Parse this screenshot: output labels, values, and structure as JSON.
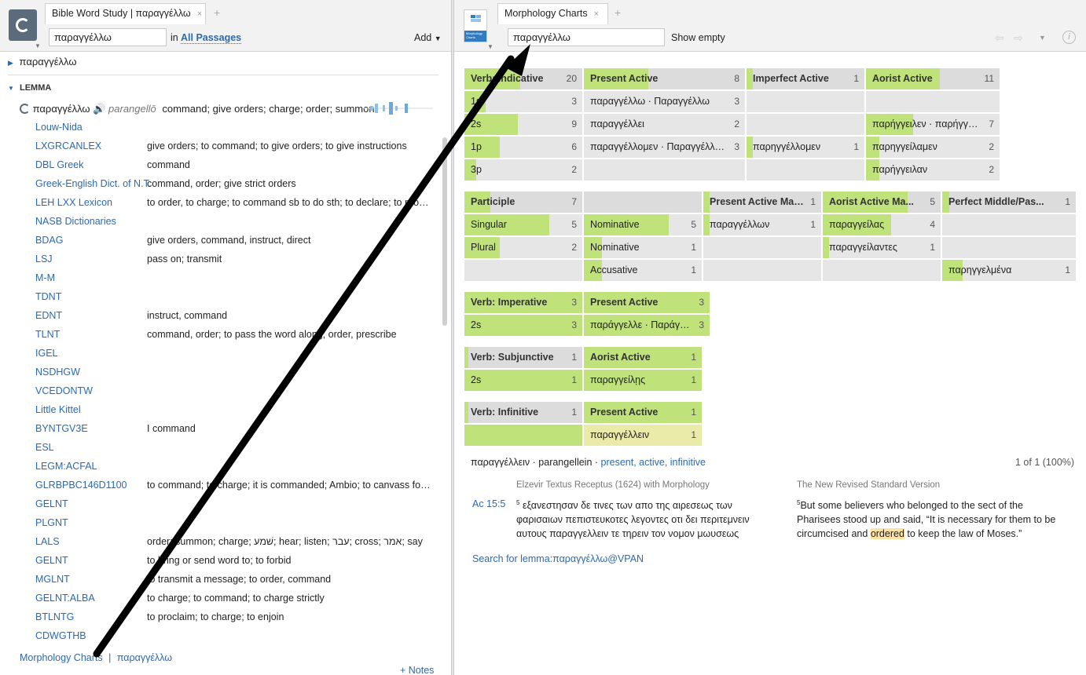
{
  "left": {
    "tab_title": "Bible Word Study | παραγγέλλω",
    "tab_close": "×",
    "tab_plus": "+",
    "search_value": "παραγγέλλω",
    "in_label": "in",
    "range_label": "All Passages",
    "add_label": "Add",
    "word_header": "παραγγέλλω",
    "lemma_header": "LEMMA",
    "lemma": {
      "word": "παραγγέλλω",
      "translit": "parangellō",
      "gloss": "command; give orders; charge; order; summon"
    },
    "rows": [
      {
        "name": "Louw-Nida",
        "def": ""
      },
      {
        "name": "LXGRCANLEX",
        "def": "give orders; to command; to give orders; to give instructions"
      },
      {
        "name": "DBL Greek",
        "def": "command"
      },
      {
        "name": "Greek-English Dict. of N.T.",
        "def": "command, order; give strict orders"
      },
      {
        "name": "LEH LXX Lexicon",
        "def": "to order, to charge; to command sb to do sth; to declare; to proclaim"
      },
      {
        "name": "NASB Dictionaries",
        "def": ""
      },
      {
        "name": "BDAG",
        "def": "give orders, command, instruct, direct"
      },
      {
        "name": "LSJ",
        "def": "pass on; transmit"
      },
      {
        "name": "M-M",
        "def": ""
      },
      {
        "name": "TDNT",
        "def": ""
      },
      {
        "name": "EDNT",
        "def": "instruct, command"
      },
      {
        "name": "TLNT",
        "def": "command, order; to pass the word along; order, prescribe"
      },
      {
        "name": "IGEL",
        "def": ""
      },
      {
        "name": "NSDHGW",
        "def": ""
      },
      {
        "name": "VCEDONTW",
        "def": ""
      },
      {
        "name": "Little Kittel",
        "def": ""
      },
      {
        "name": "BYNTGV3E",
        "def": "I command"
      },
      {
        "name": "ESL",
        "def": ""
      },
      {
        "name": "LEGM:ACFAL",
        "def": ""
      },
      {
        "name": "GLRBPBC146D1100",
        "def": "to command; to charge; it is commanded; Ambio; to canvass for votes"
      },
      {
        "name": "GELNT",
        "def": ""
      },
      {
        "name": "PLGNT",
        "def": ""
      },
      {
        "name": "LALS",
        "def": "order; summon; charge; שׁמע; hear; listen; עבר; cross; אמר; say"
      },
      {
        "name": "GELNT",
        "def": "to bring or send word to; to forbid"
      },
      {
        "name": "MGLNT",
        "def": "to transmit a message; to order, command"
      },
      {
        "name": "GELNT:ALBA",
        "def": "to charge; to command; to charge strictly"
      },
      {
        "name": "BTLNTG",
        "def": "to proclaim; to charge; to enjoin"
      },
      {
        "name": "CDWGTHB",
        "def": ""
      }
    ],
    "footer_link": "Morphology Charts",
    "footer_sep": "|",
    "footer_word": "παραγγέλλω",
    "notes_label": "+ Notes"
  },
  "right": {
    "tab_title": "Morphology Charts",
    "tab_close": "×",
    "tab_plus": "+",
    "icon_caption": "Morphology Charts",
    "search_value": "παραγγέλλω",
    "show_empty_label": "Show empty",
    "info_label": "i",
    "charts": [
      {
        "id": "indicative",
        "top_offset": 0,
        "columns": [
          [
            {
              "t": "Verb: Indicative",
              "n": 20,
              "f": 0.47,
              "h": true
            },
            {
              "t": "1s",
              "n": 3,
              "f": 0.18
            },
            {
              "t": "2s",
              "n": 9,
              "f": 0.45
            },
            {
              "t": "1p",
              "n": 6,
              "f": 0.3
            },
            {
              "t": "3p",
              "n": 2,
              "f": 0.1
            }
          ],
          [
            {
              "t": "Present Active",
              "n": 8,
              "f": 0.4,
              "h": true
            },
            {
              "t": "παραγγέλλω · Παραγγέλλω",
              "n": 3,
              "f": 0.0
            },
            {
              "t": "παραγγέλλει",
              "n": 2,
              "f": 0.0
            },
            {
              "t": "παραγγέλλομεν · Παραγγέλλομεν",
              "n": 3,
              "f": 0.0
            },
            {
              "t": "",
              "n": null,
              "f": 0,
              "blank": true
            }
          ],
          [
            {
              "t": "Imperfect Active",
              "n": 1,
              "f": 0.05,
              "h": true
            },
            {
              "t": "",
              "n": null,
              "f": 0,
              "blank": true
            },
            {
              "t": "",
              "n": null,
              "f": 0,
              "blank": true
            },
            {
              "t": "παρηγγέλλομεν",
              "n": 1,
              "f": 0.05
            },
            {
              "t": "",
              "n": null,
              "f": 0,
              "blank": true
            }
          ],
          [
            {
              "t": "Aorist Active",
              "n": 11,
              "f": 0.55,
              "h": true
            },
            {
              "t": "",
              "n": null,
              "f": 0,
              "blank": true
            },
            {
              "t": "παρήγγειλεν · παρήγγειλαν",
              "n": 7,
              "f": 0.35
            },
            {
              "t": "παρηγγείλαμεν",
              "n": 2,
              "f": 0.1
            },
            {
              "t": "παρήγγειλαν",
              "n": 2,
              "f": 0.1
            }
          ]
        ]
      }
    ],
    "participle": [
      [
        {
          "t": "Participle",
          "n": 7,
          "f": 0.22,
          "h": true
        },
        {
          "t": "Singular",
          "n": 5,
          "f": 0.72
        },
        {
          "t": "Plural",
          "n": 2,
          "f": 0.3
        },
        {
          "t": "",
          "n": null,
          "f": 0,
          "blank": true
        }
      ],
      [
        {
          "t": "",
          "n": null,
          "f": 0,
          "h": true,
          "blank": true
        },
        {
          "t": "Nominative",
          "n": 5,
          "f": 0.72
        },
        {
          "t": "Nominative",
          "n": 1,
          "f": 0.15
        },
        {
          "t": "Accusative",
          "n": 1,
          "f": 0.15
        }
      ],
      [
        {
          "t": "Present Active Mas...",
          "n": 1,
          "f": 0.05,
          "h": true
        },
        {
          "t": "παραγγέλλων",
          "n": 1,
          "f": 0.05
        },
        {
          "t": "",
          "n": null,
          "f": 0,
          "blank": true
        },
        {
          "t": "",
          "n": null,
          "f": 0,
          "blank": true
        }
      ],
      [
        {
          "t": "Aorist Active Ma...",
          "n": 5,
          "f": 0.72,
          "h": true
        },
        {
          "t": "παραγγείλας",
          "n": 4,
          "f": 0.58
        },
        {
          "t": "παραγγείλαντες",
          "n": 1,
          "f": 0.05
        },
        {
          "t": "",
          "n": null,
          "f": 0,
          "blank": true
        }
      ],
      [
        {
          "t": "Perfect Middle/Pas...",
          "n": 1,
          "f": 0.05,
          "h": true
        },
        {
          "t": "",
          "n": null,
          "f": 0,
          "blank": true
        },
        {
          "t": "",
          "n": null,
          "f": 0,
          "blank": true
        },
        {
          "t": "παρηγγελμένα",
          "n": 1,
          "f": 0.15
        }
      ]
    ],
    "imperative": [
      [
        {
          "t": "Verb: Imperative",
          "n": 3,
          "f": 1.0,
          "h": true
        },
        {
          "t": "2s",
          "n": 3,
          "f": 1.0
        }
      ],
      [
        {
          "t": "Present Active",
          "n": 3,
          "f": 1.0,
          "h": true
        },
        {
          "t": "παράγγελλε · Παράγγελλε",
          "n": 3,
          "f": 1.0
        }
      ]
    ],
    "subjunctive": [
      [
        {
          "t": "Verb: Subjunctive",
          "n": 1,
          "f": 0.03,
          "h": true
        },
        {
          "t": "2s",
          "n": 1,
          "f": 1.0
        }
      ],
      [
        {
          "t": "Aorist Active",
          "n": 1,
          "f": 1.0,
          "h": true
        },
        {
          "t": "παραγγείλῃς",
          "n": 1,
          "f": 1.0
        }
      ]
    ],
    "infinitive": [
      [
        {
          "t": "Verb: Infinitive",
          "n": 1,
          "f": 0.03,
          "h": true
        },
        {
          "t": "",
          "n": null,
          "f": 1.0
        }
      ],
      [
        {
          "t": "Present Active",
          "n": 1,
          "f": 1.0,
          "h": true
        },
        {
          "t": "παραγγέλλειν",
          "n": 1,
          "f": 0,
          "sel": true
        }
      ]
    ],
    "selection": {
      "word": "παραγγέλλειν · parangellein ·",
      "parse": "present, active, infinitive",
      "count": "1 of 1 (100%)"
    },
    "versions": {
      "left_title": "Elzevir Textus Receptus (1624) with Morphology",
      "right_title": "The New Revised Standard Version",
      "ref": "Ac 15:5",
      "verse_no": "5",
      "greek": [
        "εξανεστησαν δε τινες των απο της αιρεσεως των",
        "φαρισαιων πεπιστευκοτες λεγοντες οτι δει περιτεμνειν",
        "αυτους παραγγελλειν τε τηρειν τον νομον μωυσεως"
      ],
      "english_1": "But some believers who belonged to the sect of the",
      "english_2": "Pharisees stood up and said, “It is necessary for them to be",
      "english_3a": "circumcised and",
      "english_hl": "ordered",
      "english_3b": "to keep the law of Moses.”"
    },
    "search_link": "Search for lemma:παραγγέλλω@VPAN"
  },
  "colors": {
    "bar": "#bfe27a",
    "link": "#2a6ab0",
    "highlight": "#fbe3a8",
    "arrow": "#000000"
  }
}
